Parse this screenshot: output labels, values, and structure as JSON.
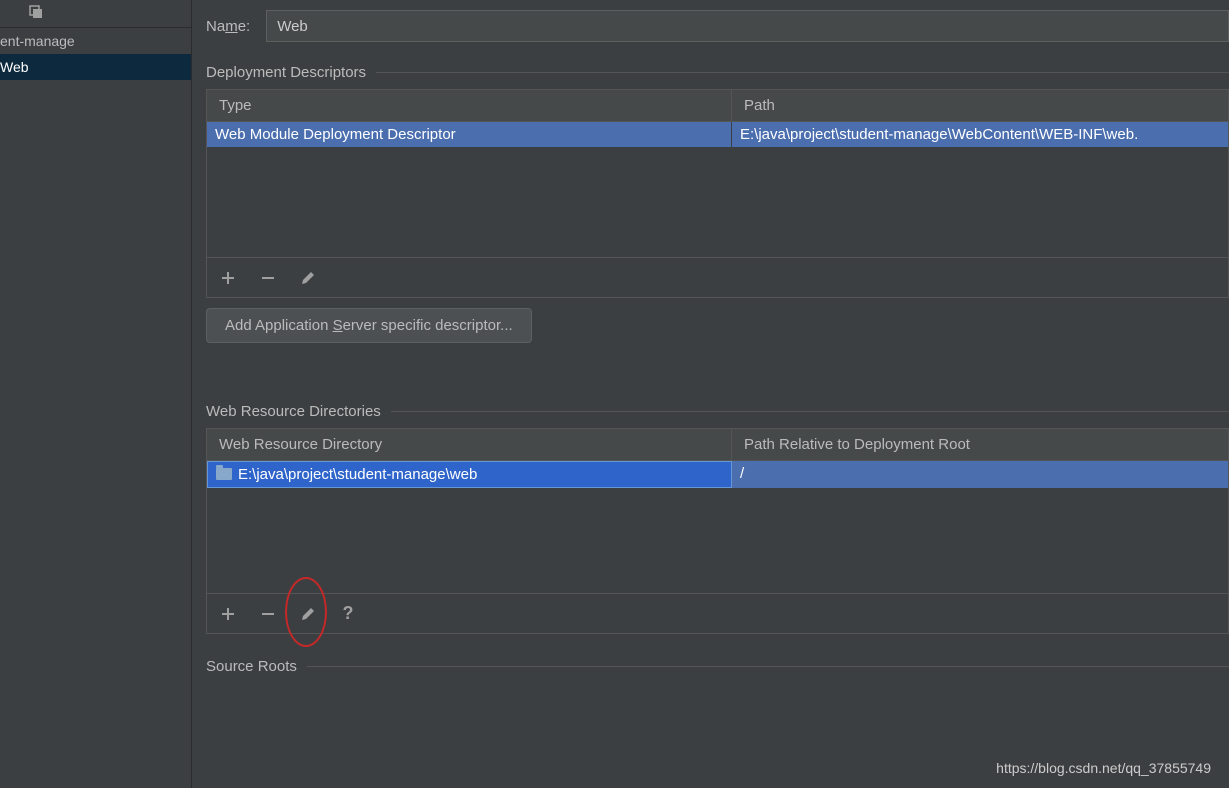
{
  "sidebar": {
    "items": [
      {
        "label": "ent-manage"
      },
      {
        "label": "Web"
      }
    ],
    "selected_index": 1
  },
  "name": {
    "label_pre": "Na",
    "label_u": "m",
    "label_post": "e:",
    "value": "Web"
  },
  "deployment_descriptors": {
    "title": "Deployment Descriptors",
    "columns": {
      "type": "Type",
      "path": "Path"
    },
    "rows": [
      {
        "type": "Web Module Deployment Descriptor",
        "path": "E:\\java\\project\\student-manage\\WebContent\\WEB-INF\\web."
      }
    ],
    "button_pre": "Add Application ",
    "button_u": "S",
    "button_post": "erver specific descriptor..."
  },
  "web_resource_directories": {
    "title": "Web Resource Directories",
    "columns": {
      "dir": "Web Resource Directory",
      "rel": "Path Relative to Deployment Root"
    },
    "rows": [
      {
        "dir": "E:\\java\\project\\student-manage\\web",
        "rel": "/"
      }
    ]
  },
  "source_roots": {
    "title": "Source Roots"
  },
  "watermark": "https://blog.csdn.net/qq_37855749"
}
